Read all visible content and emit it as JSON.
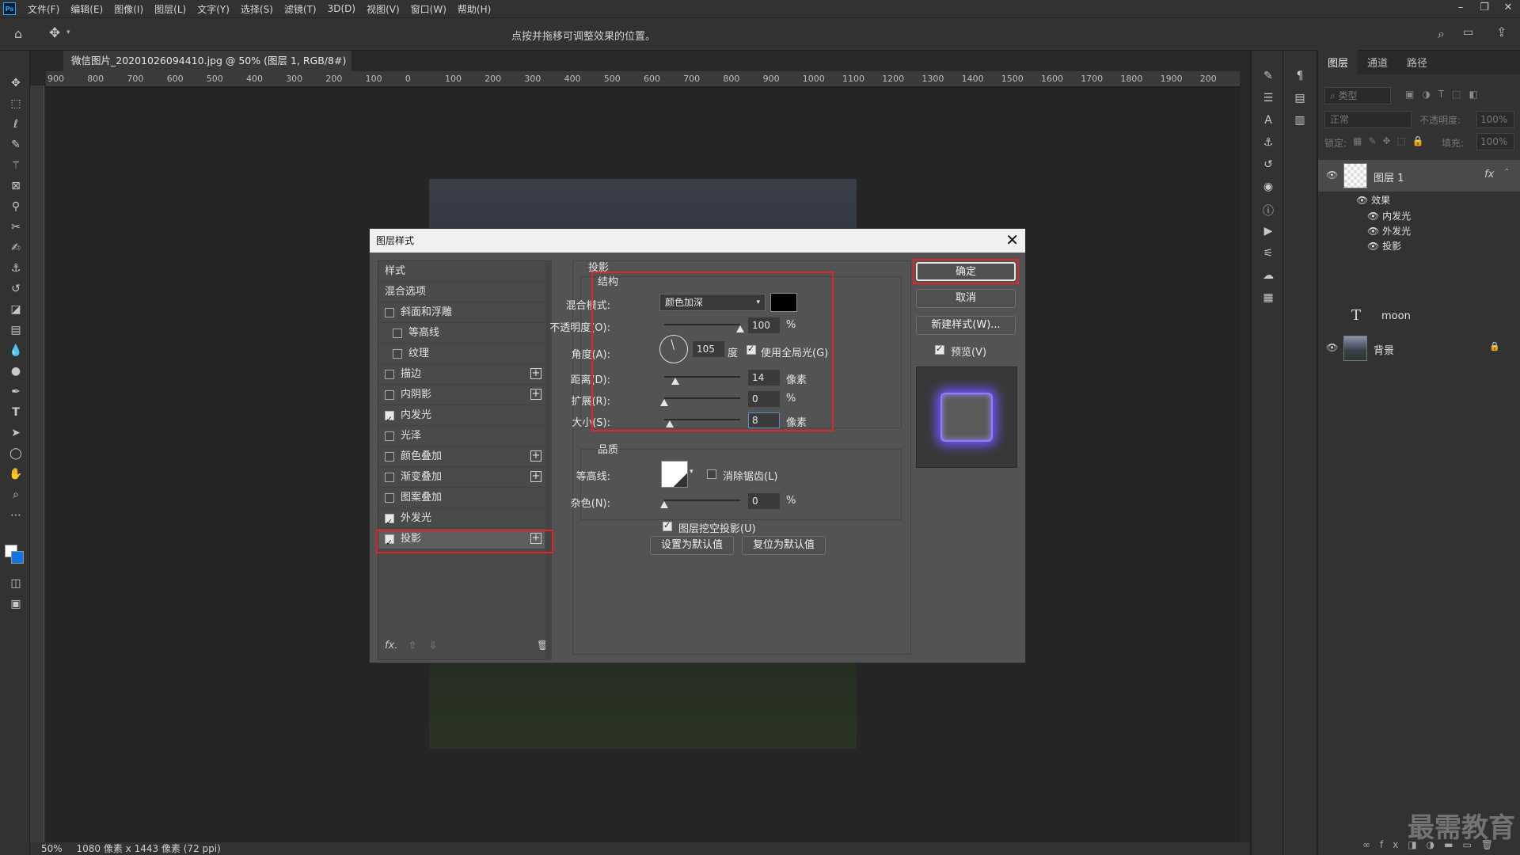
{
  "menubar": {
    "items": [
      "文件(F)",
      "编辑(E)",
      "图像(I)",
      "图层(L)",
      "文字(Y)",
      "选择(S)",
      "滤镜(T)",
      "3D(D)",
      "视图(V)",
      "窗口(W)",
      "帮助(H)"
    ],
    "ps_logo": "Ps"
  },
  "options": {
    "hint": "点按并拖移可调整效果的位置。"
  },
  "document": {
    "tab_title": "微信图片_20201026094410.jpg @ 50% (图层 1, RGB/8#) *",
    "zoom": "50%",
    "size_info": "1080 像素 x 1443 像素 (72 ppi)",
    "ruler_labels": [
      "900",
      "800",
      "700",
      "600",
      "500",
      "400",
      "300",
      "200",
      "100",
      "0",
      "100",
      "200",
      "300",
      "400",
      "500",
      "600",
      "700",
      "800",
      "900",
      "1000",
      "1100",
      "1200",
      "1300",
      "1400",
      "1500",
      "1600",
      "1700",
      "1800",
      "1900",
      "200"
    ]
  },
  "layers_panel": {
    "tabs": [
      "图层",
      "通道",
      "路径"
    ],
    "filter_placeholder": "类型",
    "blend_mode": "正常",
    "opacity_label": "不透明度:",
    "opacity_value": "100%",
    "lock_label": "锁定:",
    "fill_label": "填充:",
    "fill_value": "100%",
    "layers": [
      {
        "name": "图层 1",
        "fx": "fx"
      },
      {
        "name": "moon"
      },
      {
        "name": "背景"
      }
    ],
    "effects_header": "效果",
    "effects": [
      "内发光",
      "外发光",
      "投影"
    ]
  },
  "dialog": {
    "title": "图层样式",
    "style_items": [
      {
        "label": "样式"
      },
      {
        "label": "混合选项"
      },
      {
        "label": "斜面和浮雕",
        "checked": false
      },
      {
        "label": "等高线",
        "checked": false
      },
      {
        "label": "纹理",
        "checked": false
      },
      {
        "label": "描边",
        "checked": false
      },
      {
        "label": "内阴影",
        "checked": false
      },
      {
        "label": "内发光",
        "checked": true
      },
      {
        "label": "光泽",
        "checked": false
      },
      {
        "label": "颜色叠加",
        "checked": false
      },
      {
        "label": "渐变叠加",
        "checked": false
      },
      {
        "label": "图案叠加",
        "checked": false
      },
      {
        "label": "外发光",
        "checked": true
      },
      {
        "label": "投影",
        "checked": true
      }
    ],
    "section_title": "投影",
    "structure_title": "结构",
    "blend_mode_label": "混合模式:",
    "blend_mode_value": "颜色加深",
    "shadow_color": "#000000",
    "opacity_label": "不透明度(O):",
    "opacity_value": "100",
    "angle_label": "角度(A):",
    "angle_value": "105",
    "angle_unit": "度",
    "global_light_label": "使用全局光(G)",
    "distance_label": "距离(D):",
    "distance_value": "14",
    "spread_label": "扩展(R):",
    "spread_value": "0",
    "size_label": "大小(S):",
    "size_value": "8",
    "unit_px": "像素",
    "unit_pct": "%",
    "quality_title": "品质",
    "contour_label": "等高线:",
    "antialias_label": "消除锯齿(L)",
    "noise_label": "杂色(N):",
    "noise_value": "0",
    "knockout_label": "图层挖空投影(U)",
    "set_default": "设置为默认值",
    "reset_default": "复位为默认值",
    "ok": "确定",
    "cancel": "取消",
    "new_style": "新建样式(W)...",
    "preview_label": "预览(V)"
  },
  "watermark": "最需教育",
  "colors": {
    "accent_red": "#e0262c",
    "glow": "#7b63ff"
  }
}
